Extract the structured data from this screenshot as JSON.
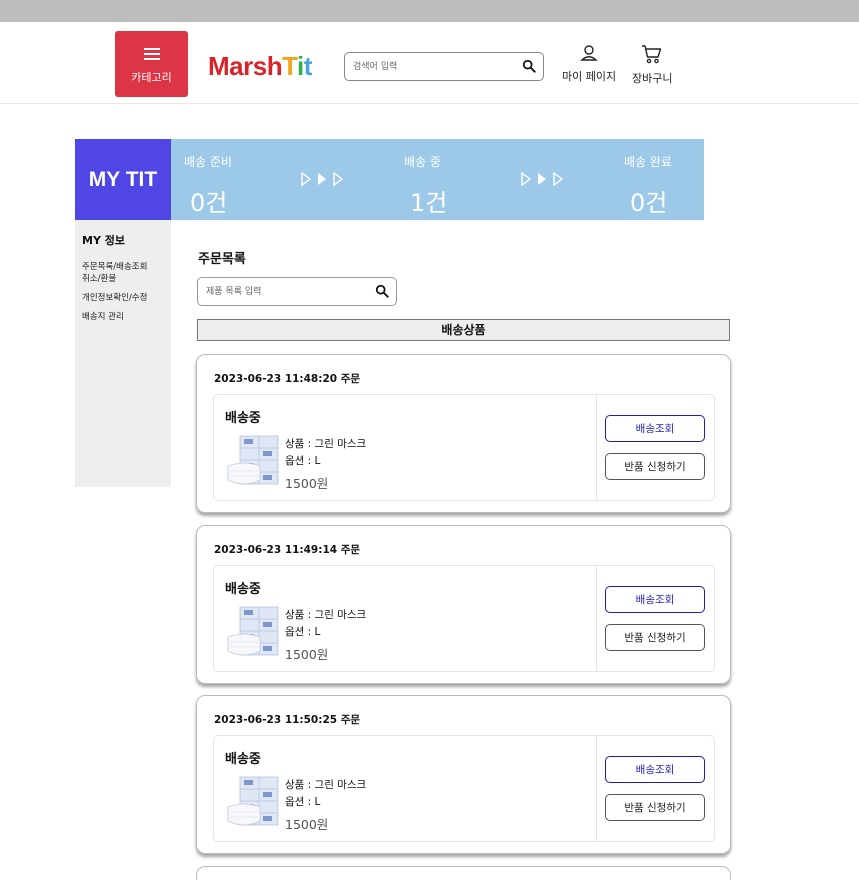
{
  "header": {
    "category_label": "카테고리",
    "logo": {
      "part1": "Marsh",
      "part2": "T",
      "part3": "i",
      "part4": "t"
    },
    "search_placeholder": "검색어 입력",
    "mypage_label": "마이 페이지",
    "cart_label": "장바구니"
  },
  "status": {
    "brand": "MY TIT",
    "items": [
      {
        "label": "배송 준비",
        "count": "0건"
      },
      {
        "label": "배송 중",
        "count": "1건"
      },
      {
        "label": "배송 완료",
        "count": "0건"
      }
    ]
  },
  "sidebar": {
    "heading": "MY 정보",
    "items": [
      "주문목록/배송조회",
      "취소/환불",
      "개인정보확인/수정",
      "배송지 관리"
    ]
  },
  "orders_section": {
    "title": "주문목록",
    "search_placeholder": "제품 목록 입력",
    "section_label": "배송상품"
  },
  "orders": [
    {
      "date": "2023-06-23 11:48:20 주문",
      "state": "배송중",
      "product": "상품 : 그린 마스크",
      "option": "옵션 : L",
      "price": "1500원",
      "track_label": "배송조회",
      "return_label": "반품 신청하기"
    },
    {
      "date": "2023-06-23 11:49:14 주문",
      "state": "배송중",
      "product": "상품 : 그린 마스크",
      "option": "옵션 : L",
      "price": "1500원",
      "track_label": "배송조회",
      "return_label": "반품 신청하기"
    },
    {
      "date": "2023-06-23 11:50:25 주문",
      "state": "배송중",
      "product": "상품 : 그린 마스크",
      "option": "옵션 : L",
      "price": "1500원",
      "track_label": "배송조회",
      "return_label": "반품 신청하기"
    }
  ],
  "colors": {
    "category_button": "#dc3545",
    "brand_box": "#4f46e5",
    "status_bar": "#9dc9e8",
    "track_button": "#1e1eb4"
  }
}
